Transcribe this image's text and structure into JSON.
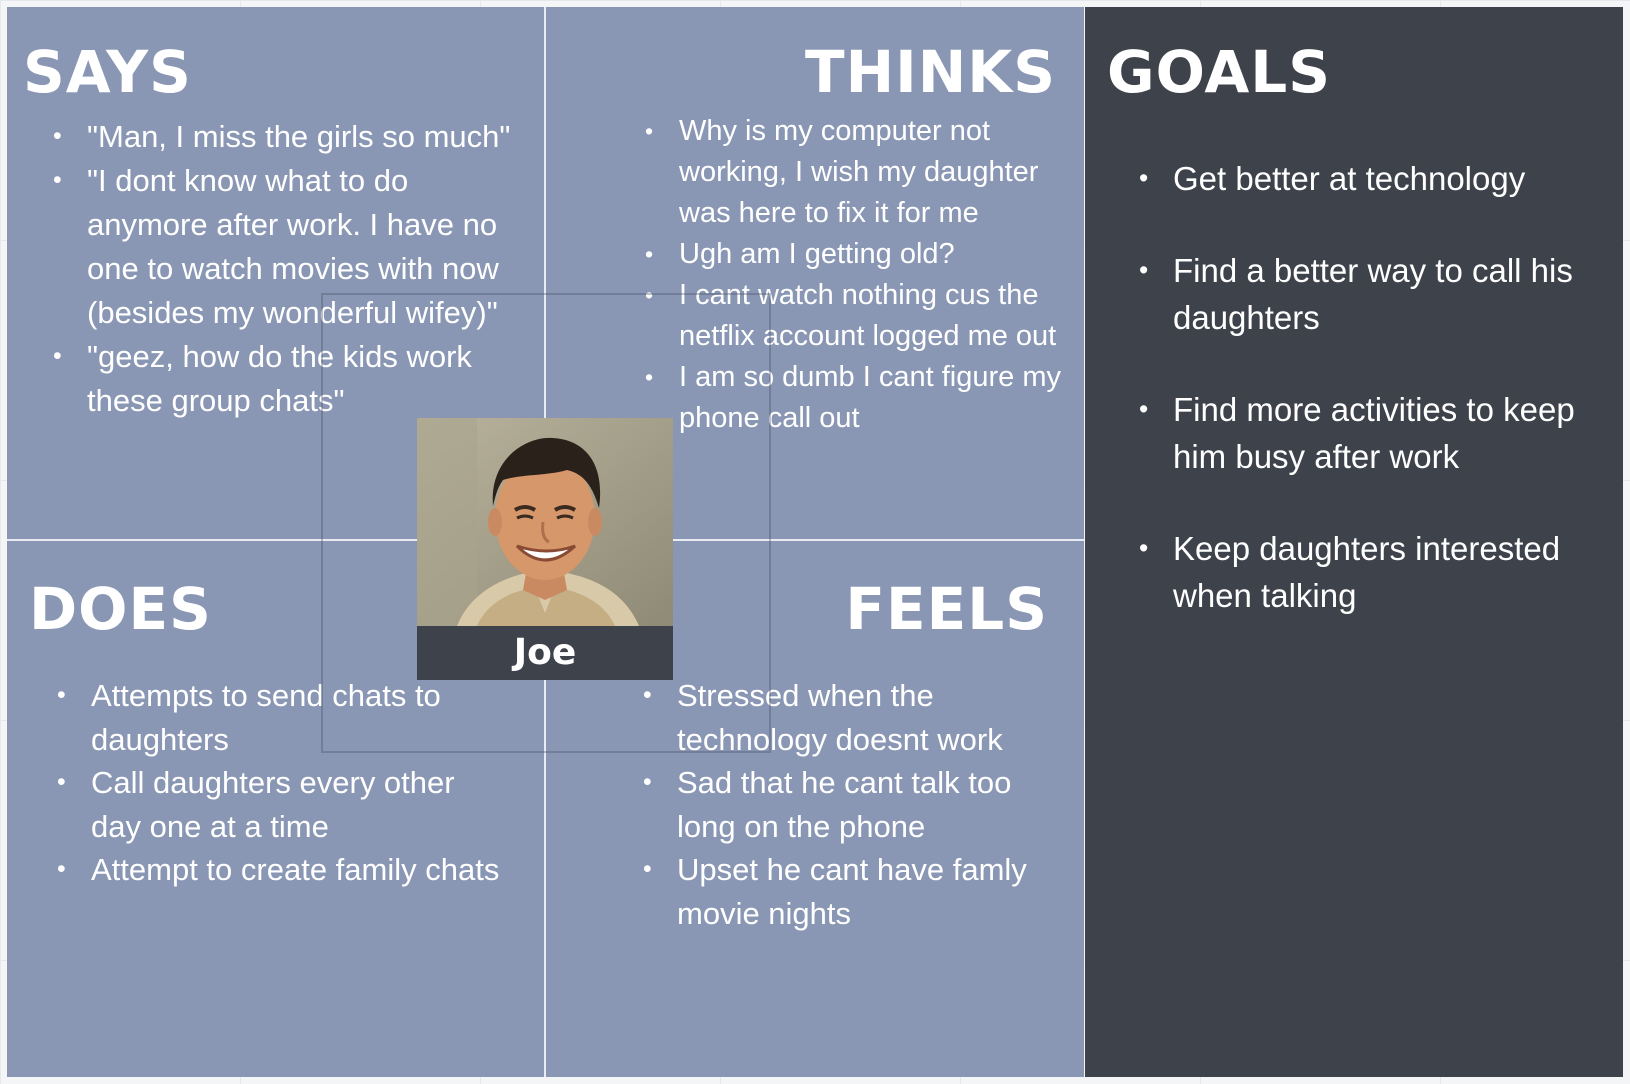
{
  "says": {
    "title": "SAYS",
    "items": [
      "\"Man, I miss the girls so much\"",
      "\"I dont know what to do anymore after work. I have no one to watch movies with now (besides my wonderful wifey)\"",
      "\"geez, how do the kids work these group chats\""
    ]
  },
  "thinks": {
    "title": "THINKS",
    "items": [
      "Why is my computer not working, I wish my daughter was here to fix it for me",
      "Ugh am I getting old?",
      "I cant watch nothing cus the netflix account logged me out",
      "I am so dumb I cant figure my phone call out"
    ]
  },
  "does": {
    "title": "DOES",
    "items": [
      "Attempts to send chats to daughters",
      "Call daughters every other day one at a time",
      "Attempt to create family chats"
    ]
  },
  "feels": {
    "title": "FEELS",
    "items": [
      "Stressed when the technology doesnt work",
      "Sad that he cant talk too long on the phone",
      "Upset he cant have famly movie nights"
    ]
  },
  "goals": {
    "title": "GOALS",
    "items": [
      "Get better at technology",
      "Find a better way to call his daughters",
      "Find more activities to keep him busy after work",
      "Keep daughters interested when talking"
    ]
  },
  "persona": {
    "name": "Joe",
    "photo_icon": "persona-photo"
  },
  "colors": {
    "quadrant": "#8a97b4",
    "goals_panel": "#3e424b",
    "text": "#ffffff",
    "name_bar": "#3e424b"
  }
}
